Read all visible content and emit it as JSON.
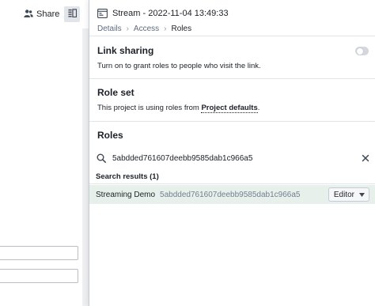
{
  "background_page": {
    "share_label": "Share"
  },
  "drawer": {
    "title": "Stream - 2022-11-04 13:49:33",
    "breadcrumb": [
      "Details",
      "Access",
      "Roles"
    ]
  },
  "link_sharing": {
    "title": "Link sharing",
    "description": "Turn on to grant roles to people who visit the link.",
    "enabled": false
  },
  "role_set": {
    "title": "Role set",
    "description_prefix": "This project is using roles from ",
    "description_link": "Project defaults",
    "description_suffix": "."
  },
  "roles": {
    "title": "Roles",
    "search_value": "5abdded761607deebb9585dab1c966a5",
    "results_label": "Search results (1)",
    "results": [
      {
        "name": "Streaming Demo",
        "id": "5abdded761607deebb9585dab1c966a5",
        "role": "Editor"
      }
    ]
  },
  "colors": {
    "result_highlight": "#e7f0ea",
    "text": "#1c2127",
    "muted_text": "#5f6b7c"
  }
}
